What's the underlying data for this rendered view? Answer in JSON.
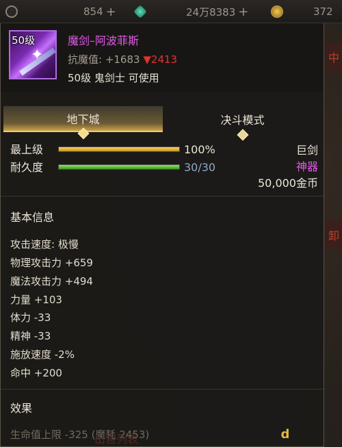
{
  "topbar": {
    "currency1": {
      "value": "854",
      "plus": "+"
    },
    "currency2": {
      "value": "24万8383",
      "plus": "+"
    },
    "currency3": {
      "value": "372"
    }
  },
  "side_tags": [
    "中",
    "卸"
  ],
  "item": {
    "level_badge": "50级",
    "name": "魔剑–阿波菲斯",
    "name_color": "#e05ae8",
    "magic_resist_label": "抗魔值: +1683",
    "magic_resist_down": "▼2413",
    "requirement": "50级 鬼剑士 可使用"
  },
  "tabs": [
    {
      "label": "地下城",
      "active": true
    },
    {
      "label": "决斗模式",
      "active": false
    }
  ],
  "stats": {
    "top_grade": {
      "label": "最上级",
      "value": "100%",
      "fill": 1.0
    },
    "durability": {
      "label": "耐久度",
      "value": "30/30",
      "fill": 1.0
    }
  },
  "right_info": {
    "weapon_type": "巨剑",
    "rarity": "神器",
    "rarity_color": "#e05ae8",
    "price": "50,000金币"
  },
  "basic_info": {
    "title": "基本信息",
    "lines": [
      "攻击速度: 极慢",
      "物理攻击力 +659",
      "魔法攻击力 +494",
      "力量 +103",
      "体力 -33",
      "精神 -33",
      "施放速度 -2%",
      "命中 +200"
    ]
  },
  "effects": {
    "title": "效果",
    "partial_line": "生命值上限 -325 (魔耗 2453)"
  },
  "bottom_label": "出售列表",
  "watermark": "d"
}
